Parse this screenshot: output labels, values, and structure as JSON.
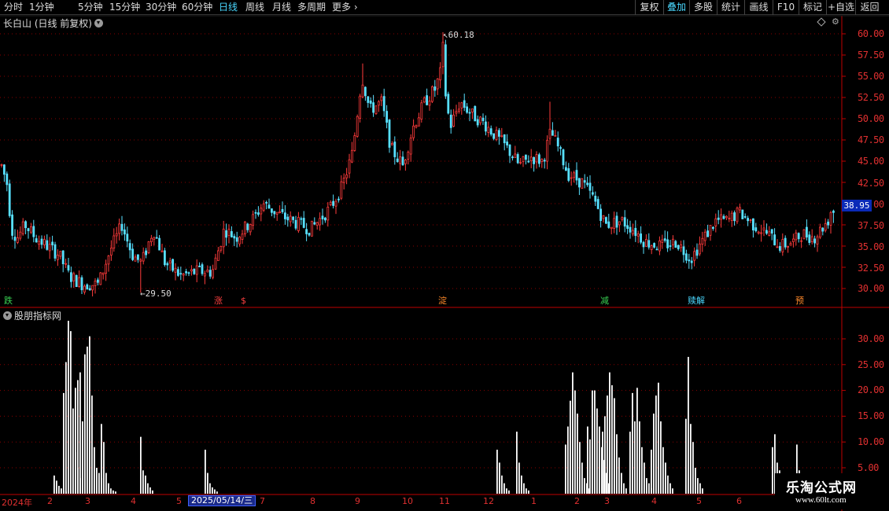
{
  "toolbar": {
    "periods": [
      "分时",
      "1分钟",
      "5分钟",
      "15分钟",
      "30分钟",
      "60分钟",
      "日线",
      "周线",
      "月线",
      "多周期",
      "更多"
    ],
    "active_period": "日线",
    "buttons": [
      "复权",
      "叠加",
      "多股",
      "统计",
      "画线",
      "F10",
      "标记",
      "+自选",
      "返回"
    ],
    "active_button": "叠加"
  },
  "main_chart": {
    "title": "长白山 (日线 前复权)",
    "y_ticks": [
      "60.00",
      "57.50",
      "55.00",
      "52.50",
      "50.00",
      "47.50",
      "45.00",
      "42.50",
      "40.00",
      "37.50",
      "35.00",
      "32.50",
      "30.00"
    ],
    "current_price": "38.95",
    "high_label": "60.18",
    "low_label": "29.50",
    "signals": [
      {
        "text": "跌",
        "color": "#39d353"
      },
      {
        "text": "涨",
        "color": "#ff4040"
      },
      {
        "text": "$",
        "color": "#ff4040"
      },
      {
        "text": "淀",
        "color": "#ff8a2a"
      },
      {
        "text": "减",
        "color": "#39d353"
      },
      {
        "text": "赎解",
        "color": "#4ad8ff"
      },
      {
        "text": "预",
        "color": "#ff8a2a"
      }
    ]
  },
  "sub_chart": {
    "title": "股朋指标网",
    "y_ticks": [
      "30.00",
      "25.00",
      "20.00",
      "15.00",
      "10.00",
      "5.00"
    ]
  },
  "x_axis": {
    "labels": [
      "2024年",
      "2",
      "3",
      "4",
      "5",
      "7",
      "8",
      "9",
      "10",
      "11",
      "12",
      "1",
      "2",
      "3",
      "4",
      "5",
      "6"
    ],
    "cursor_date": "2025/05/14/三"
  },
  "watermark": {
    "name": "乐淘公式网",
    "url": "www.60lt.com"
  },
  "colors": {
    "up": "#ff3b3b",
    "down": "#57e0ff",
    "axis": "#c00000",
    "grid": "#8a0000"
  },
  "chart_data": {
    "type": "candlestick",
    "title": "长白山 (日线 前复权)",
    "ylim": [
      29,
      61
    ],
    "high": 60.18,
    "low": 29.5,
    "last": 38.95,
    "approx_close_path": [
      {
        "x": "2024-01",
        "y": 44.0
      },
      {
        "x": "2024-02",
        "y": 31.0
      },
      {
        "x": "2024-03",
        "y": 34.0
      },
      {
        "x": "2024-04",
        "y": 32.0
      },
      {
        "x": "2024-05",
        "y": 31.5
      },
      {
        "x": "2024-07",
        "y": 37.0
      },
      {
        "x": "2024-08",
        "y": 38.0
      },
      {
        "x": "2024-09",
        "y": 54.0
      },
      {
        "x": "2024-10",
        "y": 48.0
      },
      {
        "x": "2024-11",
        "y": 57.0
      },
      {
        "x": "2024-12",
        "y": 49.0
      },
      {
        "x": "2025-01",
        "y": 45.5
      },
      {
        "x": "2025-02",
        "y": 48.0
      },
      {
        "x": "2025-03",
        "y": 39.0
      },
      {
        "x": "2025-04",
        "y": 35.0
      },
      {
        "x": "2025-05",
        "y": 37.0
      },
      {
        "x": "2025-06",
        "y": 39.0
      }
    ],
    "sub_indicator": {
      "type": "bar",
      "name": "股朋指标网",
      "ylim": [
        0,
        35
      ],
      "peaks": [
        {
          "x": "2024-02",
          "y": 33.0
        },
        {
          "x": "2024-03",
          "y": 13.5
        },
        {
          "x": "2024-04",
          "y": 11.0
        },
        {
          "x": "2024-05",
          "y": 8.5
        },
        {
          "x": "2024-12",
          "y": 8.5
        },
        {
          "x": "2024-12",
          "y": 12.0
        },
        {
          "x": "2025-02",
          "y": 23.5
        },
        {
          "x": "2025-03",
          "y": 23.5
        },
        {
          "x": "2025-04",
          "y": 21.5
        },
        {
          "x": "2025-05",
          "y": 26.5
        },
        {
          "x": "2025-06",
          "y": 11.5
        }
      ]
    }
  }
}
